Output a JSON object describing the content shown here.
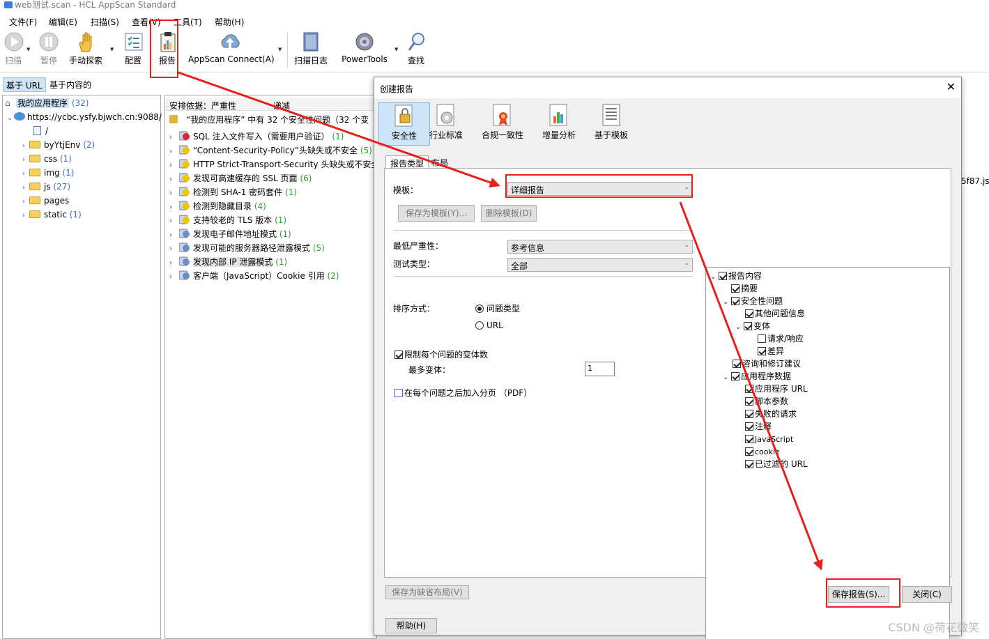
{
  "window": {
    "title": "web测试.scan - HCL AppScan Standard"
  },
  "menus": [
    "文件(F)",
    "编辑(E)",
    "扫描(S)",
    "查看(V)",
    "工具(T)",
    "帮助(H)"
  ],
  "toolbar": {
    "scan": "扫描",
    "pause": "暂停",
    "manual_explore": "手动探索",
    "config": "配置",
    "report": "报告",
    "appscan_connect": "AppScan Connect(A)",
    "scan_log": "扫描日志",
    "powertools": "PowerTools",
    "find": "查找"
  },
  "view_tabs": [
    "基于 URL",
    "基于内容的"
  ],
  "left_tree": {
    "root": {
      "label": "我的应用程序",
      "count": "(32)"
    },
    "host": "https://ycbc.ysfy.bjwch.cn:9088/",
    "slash": "/",
    "folders": [
      {
        "label": "byYtjEnv",
        "count": "(2)"
      },
      {
        "label": "css",
        "count": "(1)"
      },
      {
        "label": "img",
        "count": "(1)"
      },
      {
        "label": "js",
        "count": "(27)"
      },
      {
        "label": "pages",
        "count": ""
      },
      {
        "label": "static",
        "count": "(1)"
      }
    ]
  },
  "issues": {
    "sort_label": "安排依据：严重性",
    "sort_col2": "递减",
    "summary": "“我的应用程序” 中有 32 个安全性问题（32 个变",
    "items": [
      {
        "label": "SQL 注入文件写入（需要用户验证）",
        "count": "(1)",
        "sev": "high"
      },
      {
        "label": "“Content-Security-Policy”头缺失或不安全",
        "count": "(5)",
        "sev": "low"
      },
      {
        "label": "HTTP Strict-Transport-Security 头缺失或不安全",
        "count": "",
        "sev": "low"
      },
      {
        "label": "发现可高速缓存的 SSL 页面",
        "count": "(6)",
        "sev": "low"
      },
      {
        "label": "检测到 SHA-1 密码套件",
        "count": "(1)",
        "sev": "low"
      },
      {
        "label": "检测到隐藏目录",
        "count": "(4)",
        "sev": "low"
      },
      {
        "label": "支持较老的 TLS 版本",
        "count": "(1)",
        "sev": "low"
      },
      {
        "label": "发现电子邮件地址模式",
        "count": "(1)",
        "sev": "info"
      },
      {
        "label": "发现可能的服务器路径泄露模式",
        "count": "(5)",
        "sev": "info"
      },
      {
        "label": "发现内部 IP 泄露模式",
        "count": "(1)",
        "sev": "info"
      },
      {
        "label": "客户端（JavaScript）Cookie 引用",
        "count": "(2)",
        "sev": "info"
      }
    ]
  },
  "bg_right_text": "5f87.js",
  "dialog": {
    "title": "创建报告",
    "categories": [
      "安全性",
      "行业标准",
      "合规一致性",
      "增量分析",
      "基于模板"
    ],
    "tabs": [
      "报告类型",
      "布局"
    ],
    "template_label": "模板：",
    "template_value": "详细报告",
    "save_template": "保存为模板(Y)...",
    "delete_template": "删除模板(D)",
    "min_severity_label": "最低严重性：",
    "min_severity_value": "参考信息",
    "test_type_label": "测试类型：",
    "test_type_value": "全部",
    "sort_label": "排序方式：",
    "sort_options": [
      "问题类型",
      "URL"
    ],
    "limit_variants": "限制每个问题的变体数",
    "max_variants_label": "最多变体：",
    "max_variants_value": "1",
    "page_break": "在每个问题之后加入分页 （PDF）",
    "tree": {
      "root": "报告内容",
      "summary": "摘要",
      "security_issues": "安全性问题",
      "other_info": "其他问题信息",
      "variants": "变体",
      "req_resp": "请求/响应",
      "diff": "差异",
      "advisory": "咨询和修订建议",
      "app_data": "应用程序数据",
      "app_url": "应用程序 URL",
      "script_params": "脚本参数",
      "failed_requests": "失败的请求",
      "comments": "注释",
      "javascript": "JavaScript",
      "cookie": "cookie",
      "filtered_url": "已过滤的 URL"
    },
    "save_default_layout": "保存为缺省布局(V)",
    "save_report": "保存报告(S)...",
    "close": "关闭(C)",
    "help": "帮助(H)"
  },
  "watermark": "CSDN @荷花微笑",
  "colors": {
    "annotation_red": "#e8201a",
    "selected_blue": "#cde5f7",
    "count_blue": "#3d6bd8",
    "count_green": "#2e9e2e"
  }
}
